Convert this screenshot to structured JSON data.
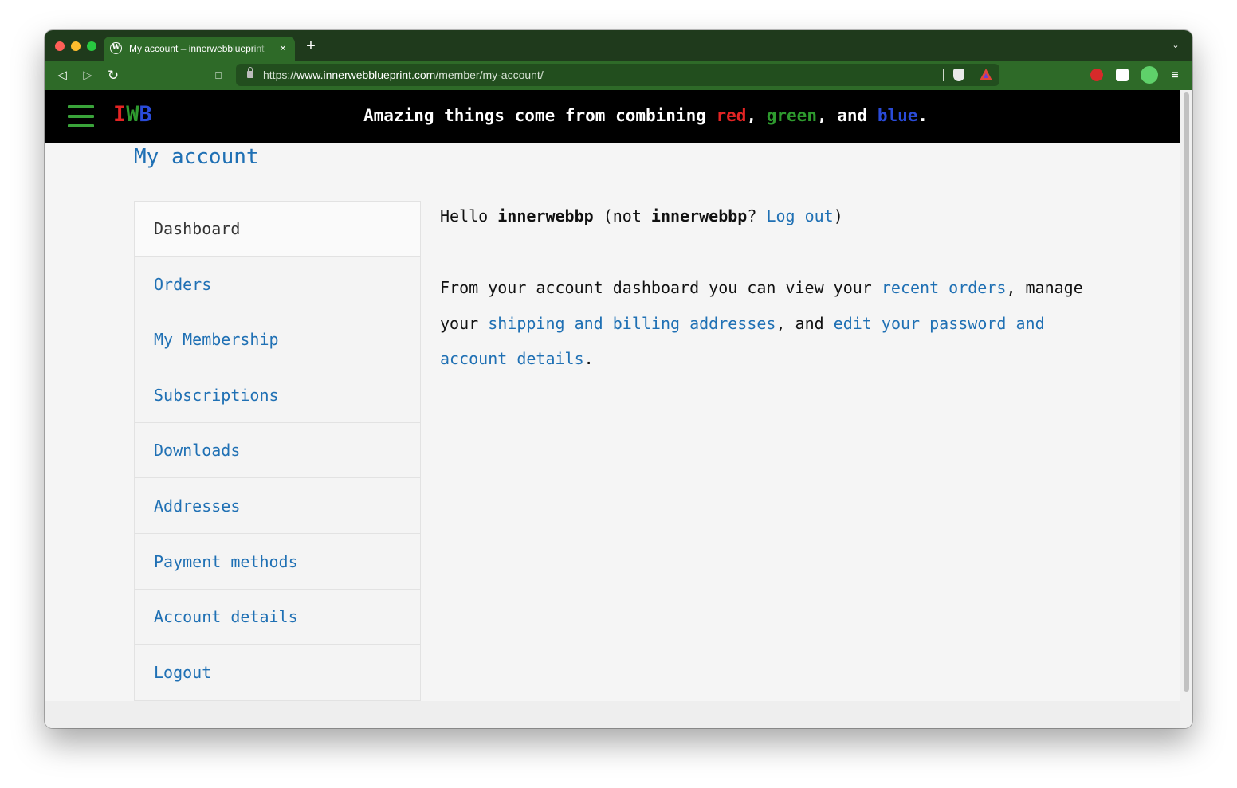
{
  "browser": {
    "tab_title": "My account – innerwebblueprint",
    "tab_close": "×",
    "new_tab": "+",
    "tab_menu": "⌄",
    "nav": {
      "back": "◁",
      "forward": "▷",
      "reload": "↻",
      "bookmark": "⎕"
    },
    "url": {
      "scheme": "https://",
      "host": "www.innerwebblueprint.com",
      "path": "/member/my-account/"
    },
    "menu": "≡"
  },
  "site": {
    "logo": {
      "i": "I",
      "w": "W",
      "b": "B"
    },
    "tagline": {
      "prefix": "Amazing things come from combining ",
      "red": "red",
      "sep1": ", ",
      "green": "green",
      "sep2": ", and ",
      "blue": "blue",
      "suffix": "."
    },
    "colors": {
      "red": "#e32424",
      "green": "#2e9a2e",
      "blue": "#2a4bd8",
      "link": "#1f70b4"
    }
  },
  "page": {
    "title": "My account",
    "nav": [
      {
        "label": "Dashboard",
        "active": true
      },
      {
        "label": "Orders"
      },
      {
        "label": "My Membership"
      },
      {
        "label": "Subscriptions"
      },
      {
        "label": "Downloads"
      },
      {
        "label": "Addresses"
      },
      {
        "label": "Payment methods"
      },
      {
        "label": "Account details"
      },
      {
        "label": "Logout"
      }
    ],
    "greeting": {
      "hello": "Hello ",
      "user": "innerwebbp",
      "not": " (not ",
      "user2": "innerwebbp",
      "q": "? ",
      "logout": "Log out",
      "close": ")"
    },
    "intro": {
      "t1": "From your account dashboard you can view your ",
      "l1": "recent orders",
      "t2": ", manage your ",
      "l2": "shipping and billing addresses",
      "t3": ", and ",
      "l3": "edit your password and account details",
      "t4": "."
    }
  }
}
